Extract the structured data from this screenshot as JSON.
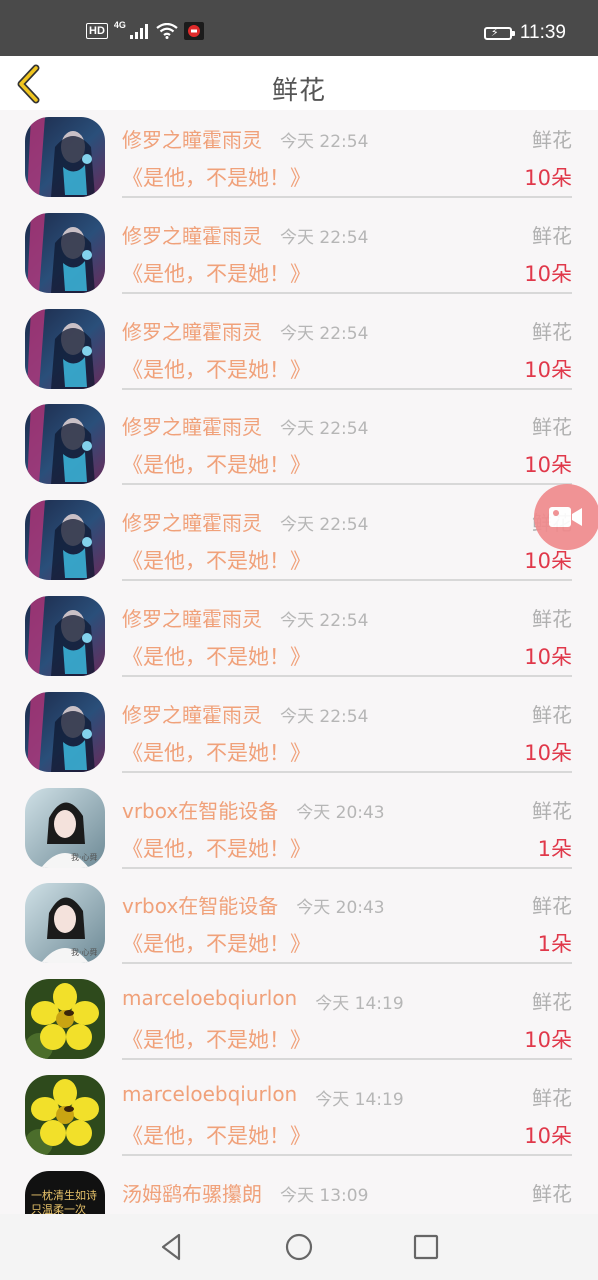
{
  "status_bar": {
    "hd_label": "HD",
    "network_label": "4G",
    "time": "11:39",
    "icons": [
      "hd-icon",
      "signal-icon",
      "wifi-icon",
      "app-notification-icon",
      "battery-charging-icon"
    ]
  },
  "header": {
    "back_icon": "chevron-left-icon",
    "title": "鲜花",
    "accent_color": "#f0c520"
  },
  "gifts": [
    {
      "name": "修罗之瞳霍雨灵",
      "time": "今天 22:54",
      "gift": "鲜花",
      "subject": "《是他，不是她！》",
      "count": "10朵",
      "avatar": "avatar-anime"
    },
    {
      "name": "修罗之瞳霍雨灵",
      "time": "今天 22:54",
      "gift": "鲜花",
      "subject": "《是他，不是她！》",
      "count": "10朵",
      "avatar": "avatar-anime"
    },
    {
      "name": "修罗之瞳霍雨灵",
      "time": "今天 22:54",
      "gift": "鲜花",
      "subject": "《是他，不是她！》",
      "count": "10朵",
      "avatar": "avatar-anime"
    },
    {
      "name": "修罗之瞳霍雨灵",
      "time": "今天 22:54",
      "gift": "鲜花",
      "subject": "《是他，不是她！》",
      "count": "10朵",
      "avatar": "avatar-anime"
    },
    {
      "name": "修罗之瞳霍雨灵",
      "time": "今天 22:54",
      "gift": "鲜花",
      "subject": "《是他，不是她！》",
      "count": "10朵",
      "avatar": "avatar-anime"
    },
    {
      "name": "修罗之瞳霍雨灵",
      "time": "今天 22:54",
      "gift": "鲜花",
      "subject": "《是他，不是她！》",
      "count": "10朵",
      "avatar": "avatar-anime"
    },
    {
      "name": "修罗之瞳霍雨灵",
      "time": "今天 22:54",
      "gift": "鲜花",
      "subject": "《是他，不是她！》",
      "count": "10朵",
      "avatar": "avatar-anime"
    },
    {
      "name": "vrbox在智能设备",
      "time": "今天 20:43",
      "gift": "鲜花",
      "subject": "《是他，不是她！》",
      "count": "1朵",
      "avatar": "avatar-portrait"
    },
    {
      "name": "vrbox在智能设备",
      "time": "今天 20:43",
      "gift": "鲜花",
      "subject": "《是他，不是她！》",
      "count": "1朵",
      "avatar": "avatar-portrait"
    },
    {
      "name": "marceloebqiurlon",
      "time": "今天 14:19",
      "gift": "鲜花",
      "subject": "《是他，不是她！》",
      "count": "10朵",
      "avatar": "avatar-flower"
    },
    {
      "name": "marceloebqiurlon",
      "time": "今天 14:19",
      "gift": "鲜花",
      "subject": "《是他，不是她！》",
      "count": "10朵",
      "avatar": "avatar-flower"
    },
    {
      "name": "汤姆鹞布骡攥朗",
      "time": "今天 13:09",
      "gift": "鲜花",
      "subject": "",
      "count": "",
      "avatar": "avatar-text",
      "avatar_text": [
        "一枕清生如诗",
        "只温柔一次"
      ]
    }
  ],
  "colors": {
    "name": "#f0a17a",
    "count": "#e0384a",
    "fab": "#f08b8d"
  },
  "fab": {
    "icon": "video-camera-icon"
  },
  "nav_bar": {
    "icons": [
      "back-triangle-icon",
      "home-circle-icon",
      "recents-square-icon"
    ]
  }
}
